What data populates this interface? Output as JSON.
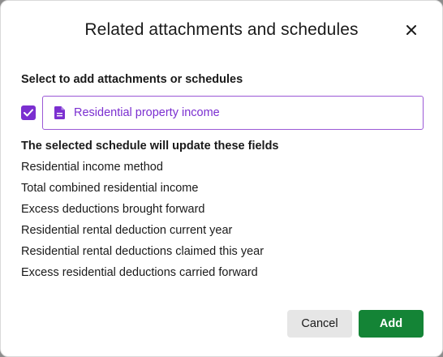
{
  "dialog": {
    "title": "Related attachments and schedules",
    "close_icon": "close-icon",
    "section_label": "Select to add attachments or schedules",
    "option": {
      "checked": true,
      "icon": "document-icon",
      "label": "Residential property income"
    },
    "fields_heading": "The selected schedule will update these fields",
    "fields": [
      "Residential income method",
      "Total combined residential income",
      "Excess deductions brought forward",
      "Residential rental deduction current year",
      "Residential rental deductions claimed this year",
      "Excess residential deductions carried forward"
    ],
    "buttons": {
      "cancel": "Cancel",
      "add": "Add"
    }
  },
  "colors": {
    "accent": "#7b2fd0",
    "primary_button": "#148436",
    "secondary_button": "#e6e6e6"
  }
}
